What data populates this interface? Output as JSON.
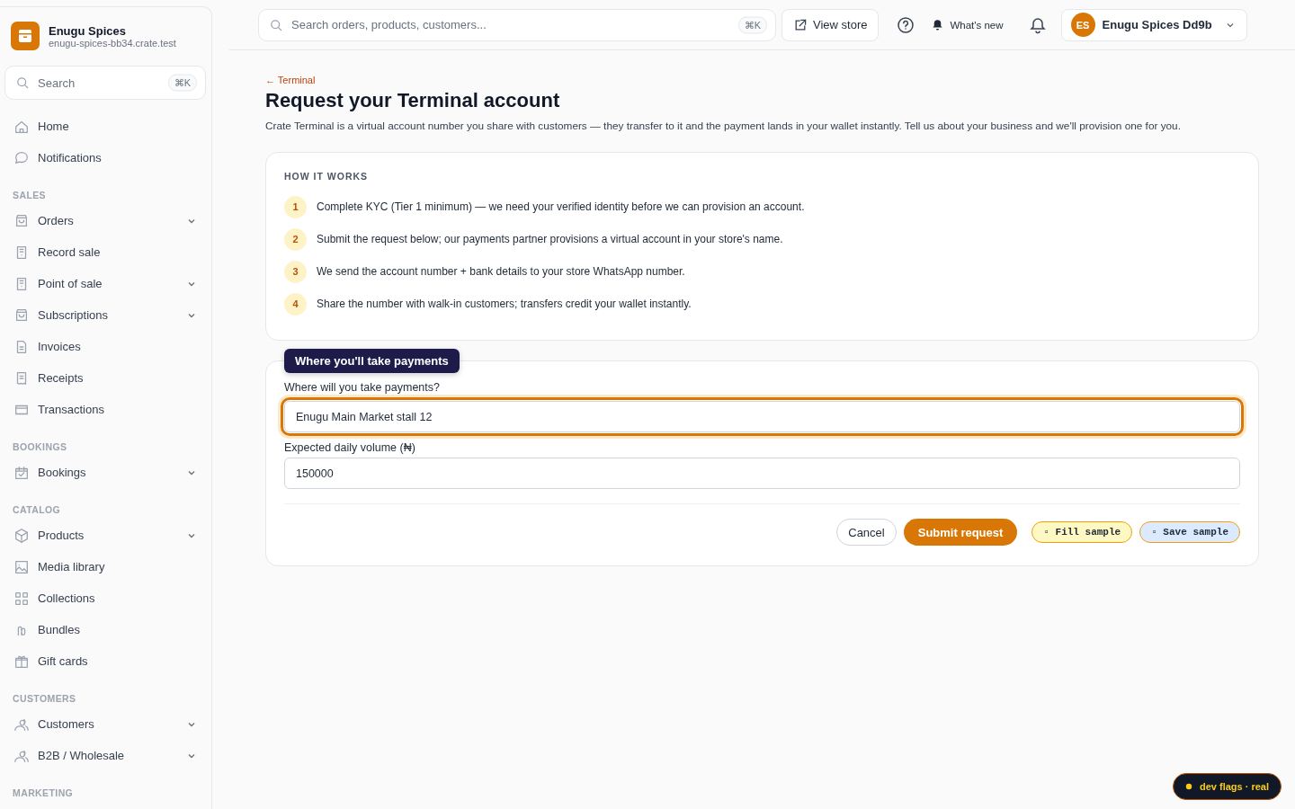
{
  "store": {
    "name": "Enugu Spices",
    "domain": "enugu-spices-bb34.crate.test"
  },
  "sidebar": {
    "search": {
      "placeholder": "Search",
      "shortcut": "⌘K"
    },
    "groups": [
      {
        "items": [
          {
            "label": "Home",
            "expandable": false
          },
          {
            "label": "Notifications",
            "expandable": false
          }
        ]
      },
      {
        "title": "SALES",
        "items": [
          {
            "label": "Orders",
            "expandable": true
          },
          {
            "label": "Record sale",
            "expandable": false
          },
          {
            "label": "Point of sale",
            "expandable": true
          },
          {
            "label": "Subscriptions",
            "expandable": true
          },
          {
            "label": "Invoices",
            "expandable": false
          },
          {
            "label": "Receipts",
            "expandable": false
          },
          {
            "label": "Transactions",
            "expandable": false
          }
        ]
      },
      {
        "title": "BOOKINGS",
        "items": [
          {
            "label": "Bookings",
            "expandable": true
          }
        ]
      },
      {
        "title": "CATALOG",
        "items": [
          {
            "label": "Products",
            "expandable": true
          },
          {
            "label": "Media library",
            "expandable": false
          },
          {
            "label": "Collections",
            "expandable": false
          },
          {
            "label": "Bundles",
            "expandable": false
          },
          {
            "label": "Gift cards",
            "expandable": false
          }
        ]
      },
      {
        "title": "CUSTOMERS",
        "items": [
          {
            "label": "Customers",
            "expandable": true
          },
          {
            "label": "B2B / Wholesale",
            "expandable": true
          }
        ]
      },
      {
        "title": "MARKETING"
      }
    ]
  },
  "topbar": {
    "search": {
      "placeholder": "Search orders, products, customers...",
      "shortcut": "⌘K"
    },
    "view_store": "View store",
    "whats_new": "What's new",
    "account": {
      "initials": "ES",
      "name": "Enugu Spices Dd9b"
    }
  },
  "breadcrumb": "← Terminal",
  "title": "Request your Terminal account",
  "intro": "Crate Terminal is a virtual account number you share with customers — they transfer to it and the payment lands in your wallet instantly. Tell us about your business and we'll provision one for you.",
  "how_it_works": {
    "heading": "HOW IT WORKS",
    "steps": [
      {
        "number": "1",
        "text": "Complete KYC (Tier 1 minimum) — we need your verified identity before we can provision an account."
      },
      {
        "number": "2",
        "text": "Submit the request below; our payments partner provisions a virtual account in your store's name."
      },
      {
        "number": "3",
        "text": "We send the account number + bank details to your store WhatsApp number."
      },
      {
        "number": "4",
        "text": "Share the number with walk-in customers; transfers credit your wallet instantly."
      }
    ]
  },
  "form": {
    "tooltip": "Where you'll take payments",
    "fields": [
      {
        "label": "Where will you take payments?",
        "value": "Enugu Main Market stall 12",
        "focused": true
      },
      {
        "label": "Expected daily volume (₦)",
        "value": "150000",
        "focused": false
      }
    ],
    "buttons": [
      {
        "kind": "secondary",
        "label": "Cancel"
      },
      {
        "kind": "primary",
        "label": "Submit request"
      },
      {
        "kind": "fill",
        "label": "▫ Fill sample"
      },
      {
        "kind": "save",
        "label": "▫ Save sample"
      }
    ]
  },
  "dev_flags": "dev flags · real"
}
